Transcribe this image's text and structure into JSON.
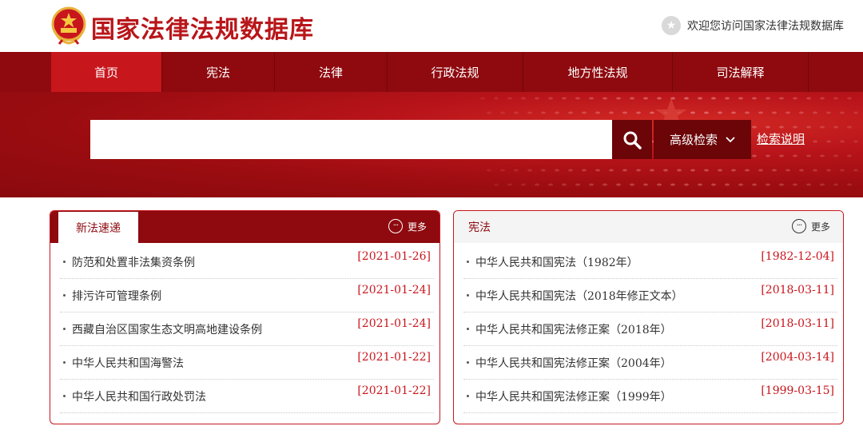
{
  "header": {
    "site_title": "国家法律法规数据库",
    "welcome_text": "欢迎您访问国家法律法规数据库",
    "welcome_icon": "star-icon"
  },
  "nav": {
    "items": [
      {
        "label": "首页",
        "active": true
      },
      {
        "label": "宪法"
      },
      {
        "label": "法律"
      },
      {
        "label": "行政法规"
      },
      {
        "label": "地方性法规"
      },
      {
        "label": "司法解释"
      }
    ]
  },
  "search": {
    "placeholder": "",
    "search_icon": "search-icon",
    "advanced_label": "高级检索",
    "help_link": "检索说明"
  },
  "panels": {
    "left": {
      "title": "新法速递",
      "more_label": "更多",
      "items": [
        {
          "title": "防范和处置非法集资条例",
          "date": "[2021-01-26]"
        },
        {
          "title": "排污许可管理条例",
          "date": "[2021-01-24]"
        },
        {
          "title": "西藏自治区国家生态文明高地建设条例",
          "date": "[2021-01-24]"
        },
        {
          "title": "中华人民共和国海警法",
          "date": "[2021-01-22]"
        },
        {
          "title": "中华人民共和国行政处罚法",
          "date": "[2021-01-22]"
        }
      ]
    },
    "right": {
      "title": "宪法",
      "more_label": "更多",
      "items": [
        {
          "title": "中华人民共和国宪法（1982年）",
          "date": "[1982-12-04]"
        },
        {
          "title": "中华人民共和国宪法（2018年修正文本）",
          "date": "[2018-03-11]"
        },
        {
          "title": "中华人民共和国宪法修正案（2018年）",
          "date": "[2018-03-11]"
        },
        {
          "title": "中华人民共和国宪法修正案（2004年）",
          "date": "[2004-03-14]"
        },
        {
          "title": "中华人民共和国宪法修正案（1999年）",
          "date": "[1999-03-15]"
        }
      ]
    }
  },
  "colors": {
    "brand_red": "#c8161d",
    "dark_red": "#8e0a0f"
  }
}
